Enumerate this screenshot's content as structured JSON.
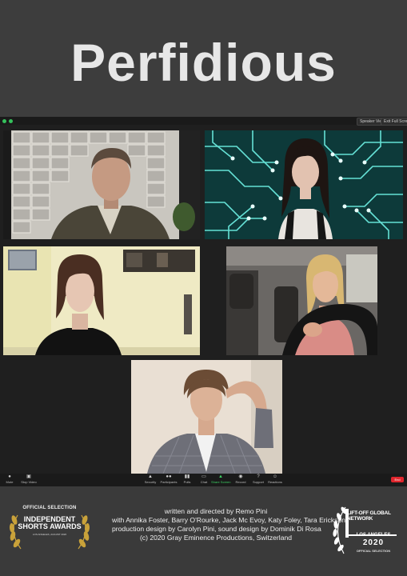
{
  "poster": {
    "title": "Perfidious"
  },
  "window": {
    "buttons": {
      "speaker_view": "Speaker View",
      "exit_fullscreen": "Exit Full Screen"
    }
  },
  "participants": [
    {
      "icon": "participant-video-tile"
    },
    {
      "icon": "participant-video-tile"
    },
    {
      "icon": "participant-video-tile"
    },
    {
      "icon": "participant-video-tile"
    },
    {
      "icon": "participant-video-tile"
    }
  ],
  "controls": {
    "mute": "Mute",
    "stop_video": "Stop Video",
    "security": "Security",
    "participants": "Participants",
    "polls": "Polls",
    "chat": "Chat",
    "share_screen": "Share Screen",
    "record": "Record",
    "support": "Support",
    "reactions": "Reactions",
    "end": "End",
    "share_color": "#3ccf63",
    "end_color": "#e0262d"
  },
  "credits": {
    "line1": "written and directed by Remo Pini",
    "line2": "with Annika Foster, Barry O'Rourke, Jack Mc Evoy, Katy Foley, Tara Erickson",
    "line3": "production design by Carolyn Pini, sound design by Dominik Di Rosa",
    "line4": "(c) 2020 Gray Eminence Productions, Switzerland"
  },
  "award_left": {
    "official": "OFFICIAL SELECTION",
    "name": "INDEPENDENT SHORTS AWARDS",
    "sub": "LOS ANGELES, AUGUST 2020"
  },
  "award_right": {
    "name": "LIFT-OFF GLOBAL NETWORK",
    "city": "LOS ANGELES",
    "year": "2020",
    "selection": "OFFICIAL SELECTION"
  }
}
